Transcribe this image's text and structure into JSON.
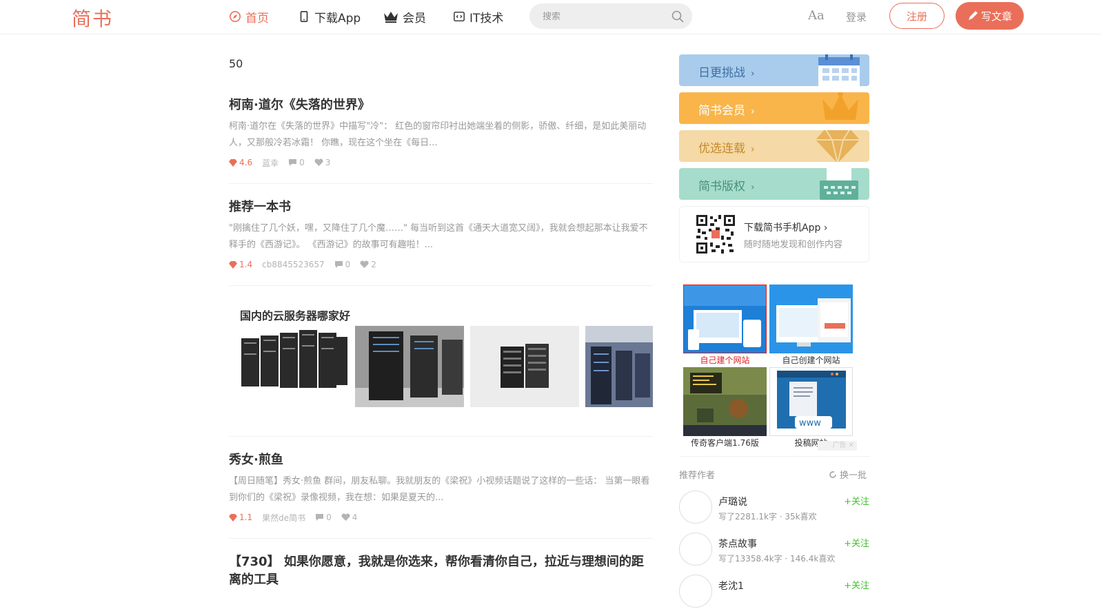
{
  "header": {
    "logo": "简书",
    "nav": [
      {
        "label": "首页",
        "icon": "compass-icon",
        "active": true
      },
      {
        "label": "下载App",
        "icon": "phone-icon",
        "active": false
      },
      {
        "label": "会员",
        "icon": "crown-icon",
        "active": false
      },
      {
        "label": "IT技术",
        "icon": "code-icon",
        "active": false
      }
    ],
    "search_placeholder": "搜索",
    "font_toggle": "Aa",
    "login": "登录",
    "signup": "注册",
    "write": "写文章"
  },
  "main": {
    "counter": "50",
    "articles": [
      {
        "title": "柯南·道尔《失落的世界》",
        "abstract": "柯南·道尔在《失落的世界》中描写\"冷\"：  红色的窗帘印衬出她端坐着的侧影，骄傲、纤细，是如此美丽动人，又那般冷若冰霜！ 你瞧，现在这个坐在《每日...",
        "diamond": "4.6",
        "author": "蓝幸",
        "comments": "0",
        "likes": "3"
      },
      {
        "title": "推荐一本书",
        "abstract": "\"刚擒住了几个妖，嘿，又降住了几个魔……\" 每当听到这首《通天大道宽又阔》，我就会想起那本让我爱不释手的《西游记》。 《西游记》的故事可有趣啦！...",
        "diamond": "1.4",
        "author": "cb8845523657",
        "comments": "0",
        "likes": "2"
      },
      {
        "title": "秀女·煎鱼",
        "abstract": "【周日随笔】秀女·煎鱼 群间，朋友私聊。我就朋友的《梁祝》小视频话题说了这样的一些话： 当第一眼看到你们的《梁祝》录像视频，我在想：如果是夏天的...",
        "diamond": "1.1",
        "author": "果然de简书",
        "comments": "0",
        "likes": "4"
      },
      {
        "title": "【730】 如果你愿意，我就是你选来，帮你看清你自己，拉近与理想间的距离的工具"
      }
    ],
    "ad": {
      "title": "国内的云服务器哪家好"
    }
  },
  "sidebar": {
    "boards": [
      {
        "label": "日更挑战",
        "color": "#a9ccec",
        "icon": "calendar-icon"
      },
      {
        "label": "简书会员",
        "color": "#f9b54a",
        "icon": "crown-icon"
      },
      {
        "label": "优选连载",
        "color": "#f5d9a6",
        "icon": "diamond-icon"
      },
      {
        "label": "简书版权",
        "color": "#a6dccb",
        "icon": "typewriter-icon"
      }
    ],
    "download": {
      "title": "下载简书手机App",
      "subtitle": "随时随地发现和创作内容"
    },
    "ads": [
      {
        "label": "自己建个网站"
      },
      {
        "label": "自己创建个网站"
      },
      {
        "label": "传奇客户端1.76版"
      },
      {
        "label": "投稿网站"
      }
    ],
    "ad_tag": "广告",
    "recommend": {
      "title": "推荐作者",
      "swap": "换一批",
      "authors": [
        {
          "name": "卢璐说",
          "info": "写了2281.1k字 · 35k喜欢",
          "follow": "+关注"
        },
        {
          "name": "茶点故事",
          "info": "写了13358.4k字 · 146.4k喜欢",
          "follow": "+关注"
        },
        {
          "name": "老沈1",
          "info": "",
          "follow": "+关注"
        }
      ]
    }
  }
}
